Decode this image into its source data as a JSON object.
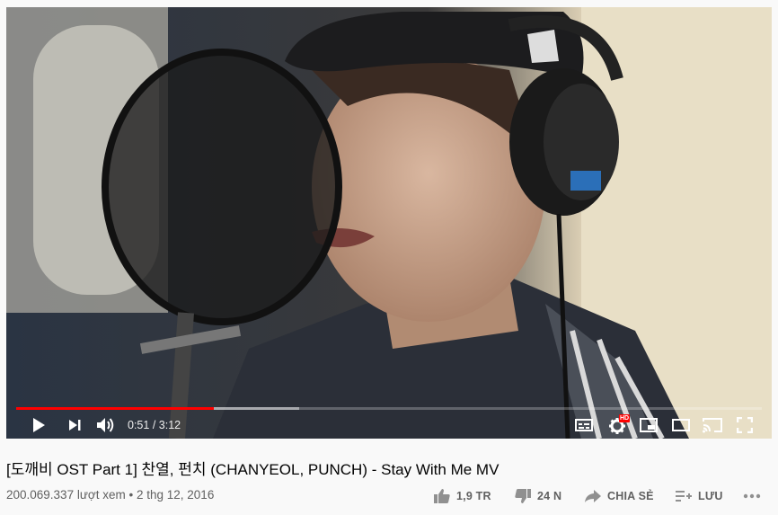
{
  "video": {
    "title": "[도깨비 OST Part 1] 찬열, 펀치 (CHANYEOL, PUNCH) - Stay With Me MV",
    "views": "200.069.337 lượt xem",
    "date_separator": "•",
    "date": "2 thg 12, 2016",
    "progress_fraction": 0.265,
    "buffered_fraction": 0.38
  },
  "player": {
    "current_time": "0:51",
    "duration": "3:12",
    "time_separator": "/",
    "hd_badge": "HD"
  },
  "actions": {
    "like_count": "1,9 TR",
    "dislike_count": "24 N",
    "share_label": "CHIA SẺ",
    "save_label": "LƯU",
    "more_icon": "more-horizontal-icon"
  },
  "colors": {
    "progress": "#ff0000",
    "hd_badge": "#ff0000",
    "text_secondary": "#606060"
  }
}
